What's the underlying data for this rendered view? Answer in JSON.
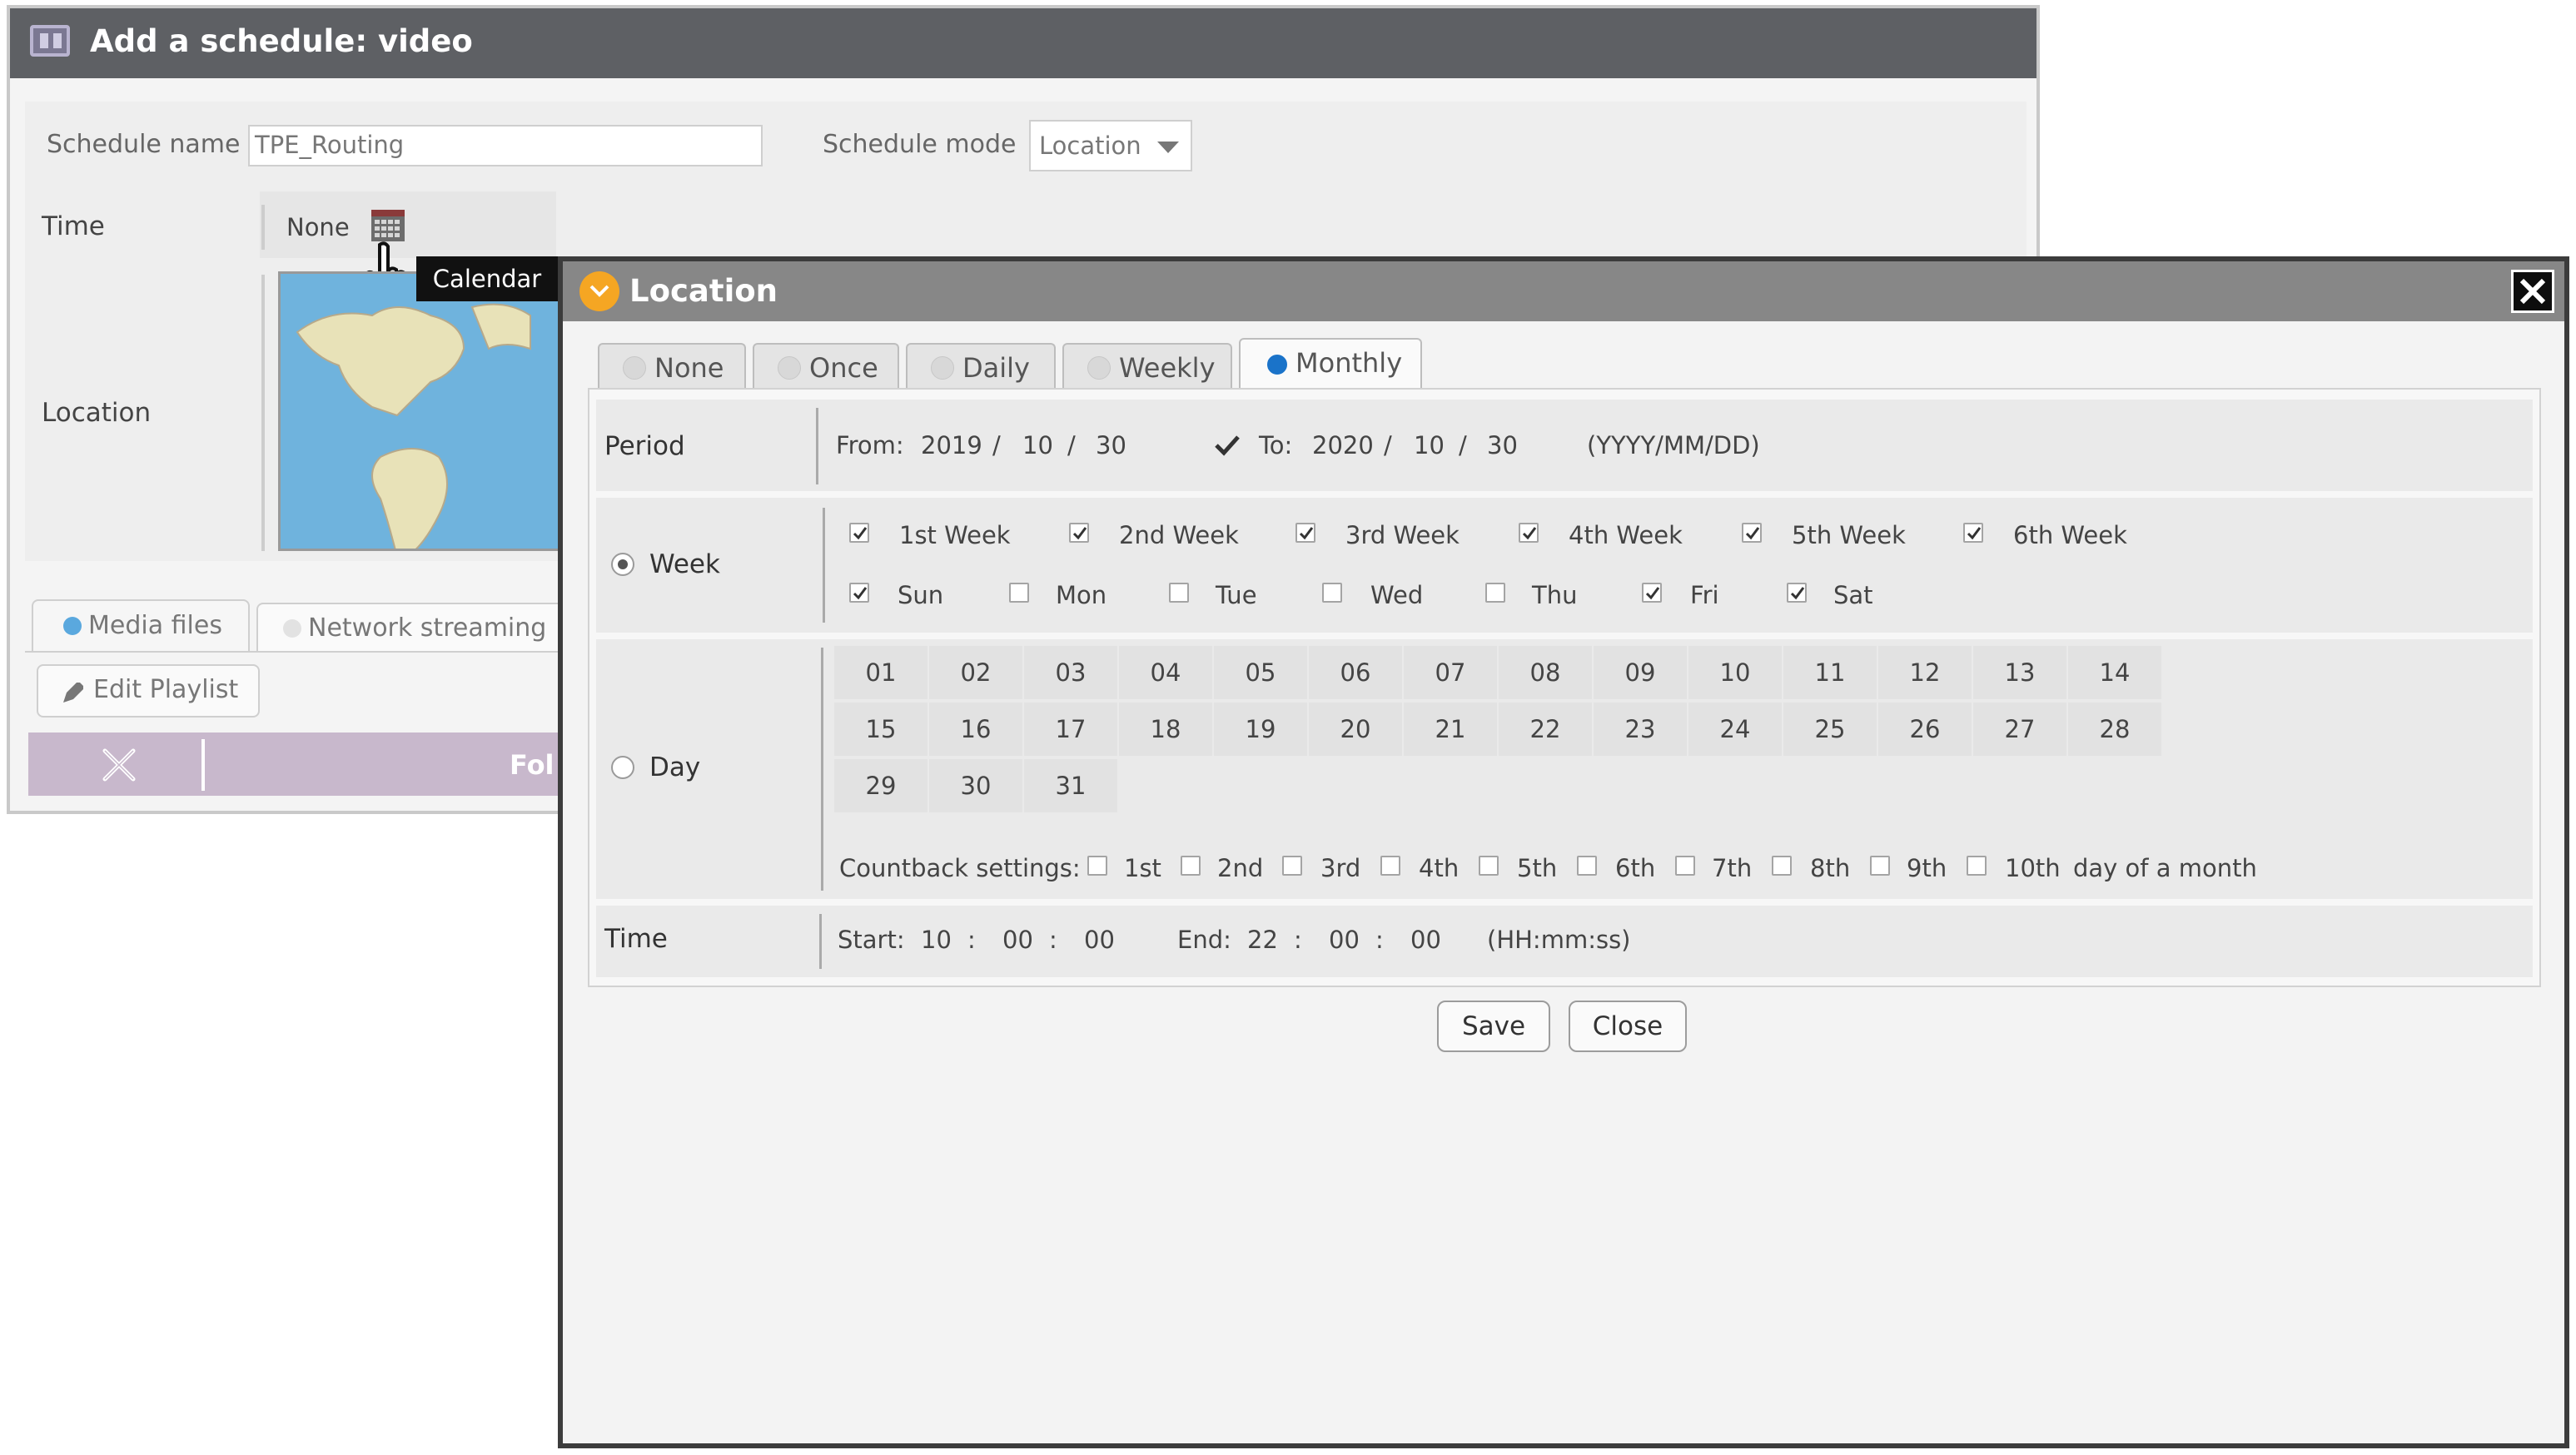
{
  "window": {
    "title": "Add a schedule: video",
    "schedule_name_label": "Schedule name",
    "schedule_name_value": "TPE_Routing",
    "schedule_mode_label": "Schedule mode",
    "schedule_mode_value": "Location",
    "time_label": "Time",
    "time_value": "None",
    "location_label": "Location",
    "tooltip": "Calendar",
    "tabs": [
      "Media files",
      "Network streaming"
    ],
    "edit_playlist": "Edit Playlist",
    "folder_label_partial": "Fol"
  },
  "dialog": {
    "title": "Location",
    "tabs": [
      "None",
      "Once",
      "Daily",
      "Weekly",
      "Monthly"
    ],
    "active_tab": "Monthly",
    "period": {
      "label": "Period",
      "from_label": "From:",
      "from": [
        "2019",
        "10",
        "30"
      ],
      "to_checked": true,
      "to_label": "To:",
      "to": [
        "2020",
        "10",
        "30"
      ],
      "sep": "/",
      "format": "(YYYY/MM/DD)"
    },
    "week": {
      "label": "Week",
      "selected": true,
      "weeks": [
        {
          "label": "1st Week",
          "checked": true
        },
        {
          "label": "2nd Week",
          "checked": true
        },
        {
          "label": "3rd Week",
          "checked": true
        },
        {
          "label": "4th Week",
          "checked": true
        },
        {
          "label": "5th Week",
          "checked": true
        },
        {
          "label": "6th Week",
          "checked": true
        }
      ],
      "days": [
        {
          "label": "Sun",
          "checked": true
        },
        {
          "label": "Mon",
          "checked": false
        },
        {
          "label": "Tue",
          "checked": false
        },
        {
          "label": "Wed",
          "checked": false
        },
        {
          "label": "Thu",
          "checked": false
        },
        {
          "label": "Fri",
          "checked": true
        },
        {
          "label": "Sat",
          "checked": true
        }
      ]
    },
    "day": {
      "label": "Day",
      "selected": false,
      "numbers": [
        "01",
        "02",
        "03",
        "04",
        "05",
        "06",
        "07",
        "08",
        "09",
        "10",
        "11",
        "12",
        "13",
        "14",
        "15",
        "16",
        "17",
        "18",
        "19",
        "20",
        "21",
        "22",
        "23",
        "24",
        "25",
        "26",
        "27",
        "28",
        "29",
        "30",
        "31"
      ],
      "countback_label": "Countback settings:",
      "countback": [
        "1st",
        "2nd",
        "3rd",
        "4th",
        "5th",
        "6th",
        "7th",
        "8th",
        "9th",
        "10th"
      ],
      "countback_suffix": "day of a month"
    },
    "time": {
      "label": "Time",
      "start_label": "Start:",
      "start": [
        "10",
        "00",
        "00"
      ],
      "end_label": "End:",
      "end": [
        "22",
        "00",
        "00"
      ],
      "sep": ":",
      "format": "(HH:mm:ss)"
    },
    "save": "Save",
    "close": "Close"
  },
  "colors": {
    "title_bar_bg": "#5e6064",
    "dialog_title_bg": "#878787",
    "accent_orange": "#f5a623",
    "radio_blue": "#1a73c9",
    "playlist_bar": "#c8b8cc"
  }
}
